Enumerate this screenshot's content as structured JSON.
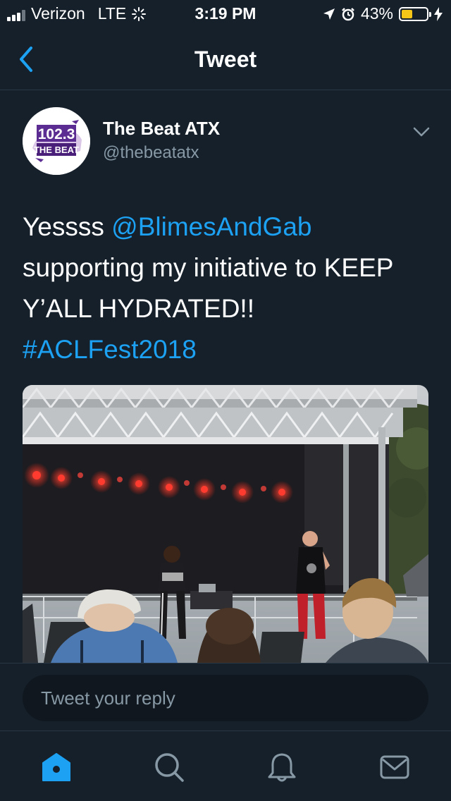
{
  "status_bar": {
    "carrier": "Verizon",
    "network": "LTE",
    "time": "3:19 PM",
    "battery": "43%",
    "battery_level": 0.43
  },
  "nav": {
    "title": "Tweet",
    "back_icon": "chevron-left-icon"
  },
  "tweet": {
    "author_name": "The Beat ATX",
    "author_handle": "@thebeatatx",
    "avatar_logo_text": "102.3 THE BEAT",
    "text": {
      "part1": "Yessss ",
      "mention": "@BlimesAndGab",
      "part2": " supporting my initiative to KEEP Y’ALL HYDRATED!!",
      "hashtag": "#ACLFest2018"
    },
    "media": "concert-stage-photo"
  },
  "reply": {
    "placeholder": "Tweet your reply"
  },
  "tab_bar": {
    "items": [
      "home-icon",
      "search-icon",
      "notifications-icon",
      "messages-icon"
    ],
    "active": "home-icon"
  },
  "colors": {
    "background": "#15202b",
    "accent": "#1da1f2",
    "secondary_text": "#8899a6",
    "battery": "#f5c518"
  }
}
